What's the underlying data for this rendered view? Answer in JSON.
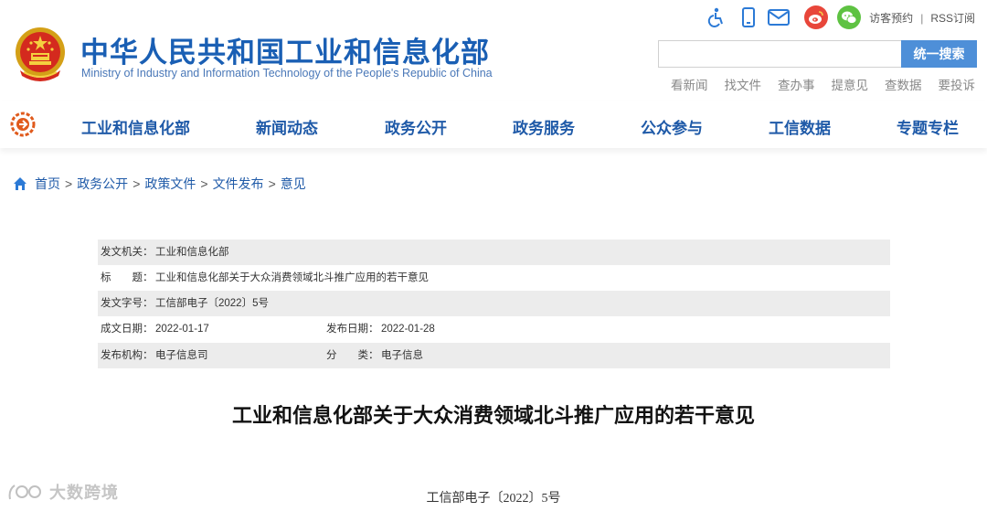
{
  "header": {
    "title_cn": "中华人民共和国工业和信息化部",
    "title_en": "Ministry of Industry and Information Technology of the People's Republic of China",
    "icons": [
      "accessibility-icon",
      "mobile-icon",
      "mail-icon",
      "weibo-icon",
      "wechat-icon"
    ],
    "top_links": {
      "visitor": "访客预约",
      "separator": "|",
      "rss": "RSS订阅"
    },
    "search": {
      "placeholder": "",
      "button": "统一搜索"
    },
    "quick_links": [
      "看新闻",
      "找文件",
      "查办事",
      "提意见",
      "查数据",
      "要投诉"
    ]
  },
  "nav": [
    "工业和信息化部",
    "新闻动态",
    "政务公开",
    "政务服务",
    "公众参与",
    "工信数据",
    "专题专栏"
  ],
  "breadcrumb": {
    "items": [
      "首页",
      "政务公开",
      "政策文件",
      "文件发布",
      "意见"
    ],
    "separator": ">"
  },
  "info": {
    "issuer_label": "发文机关：",
    "issuer": "工业和信息化部",
    "title_label": "标　　题：",
    "title": "工业和信息化部关于大众消费领域北斗推广应用的若干意见",
    "doc_no_label": "发文字号：",
    "doc_no": "工信部电子〔2022〕5号",
    "written_label": "成文日期：",
    "written": "2022-01-17",
    "published_label": "发布日期：",
    "published": "2022-01-28",
    "org_label": "发布机构：",
    "org": "电子信息司",
    "category_label": "分　　类：",
    "category": "电子信息"
  },
  "document": {
    "title": "工业和信息化部关于大众消费领域北斗推广应用的若干意见",
    "number": "工信部电子〔2022〕5号"
  },
  "watermark": "大数跨境",
  "colors": {
    "brand_blue": "#1a5fb4",
    "search_blue": "#4e8fd8",
    "row_shade": "#ececec"
  }
}
